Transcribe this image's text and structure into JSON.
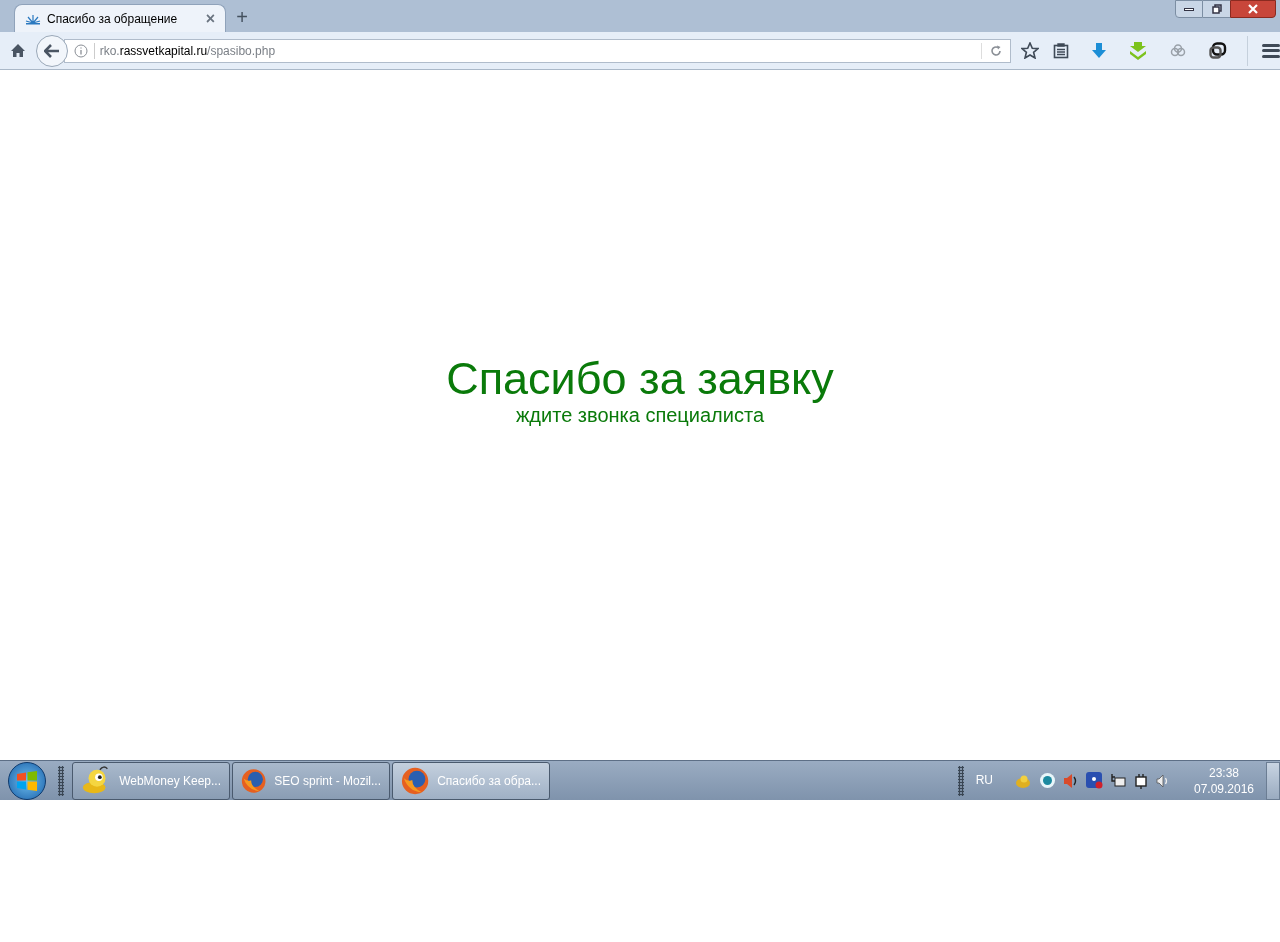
{
  "browser": {
    "tabs": [
      {
        "title": "Спасибо за обращение",
        "close": "×",
        "selected": true
      }
    ],
    "new_tab": "+",
    "url": {
      "subdomain": "rko.",
      "domain": "rassvetkapital.ru",
      "path": "/spasibo.php"
    }
  },
  "page": {
    "heading": "Спасибо за заявку",
    "subheading": "ждите звонка специалиста"
  },
  "taskbar": {
    "buttons": [
      {
        "label": "WebMoney Keep...",
        "kind": "webmoney",
        "selected": false
      },
      {
        "label": "SEO sprint - Mozil...",
        "kind": "firefox",
        "selected": false
      },
      {
        "label": "Спасибо за обра...",
        "kind": "firefox",
        "selected": true
      }
    ],
    "language": "RU",
    "time": "23:38",
    "date": "07.09.2016"
  }
}
